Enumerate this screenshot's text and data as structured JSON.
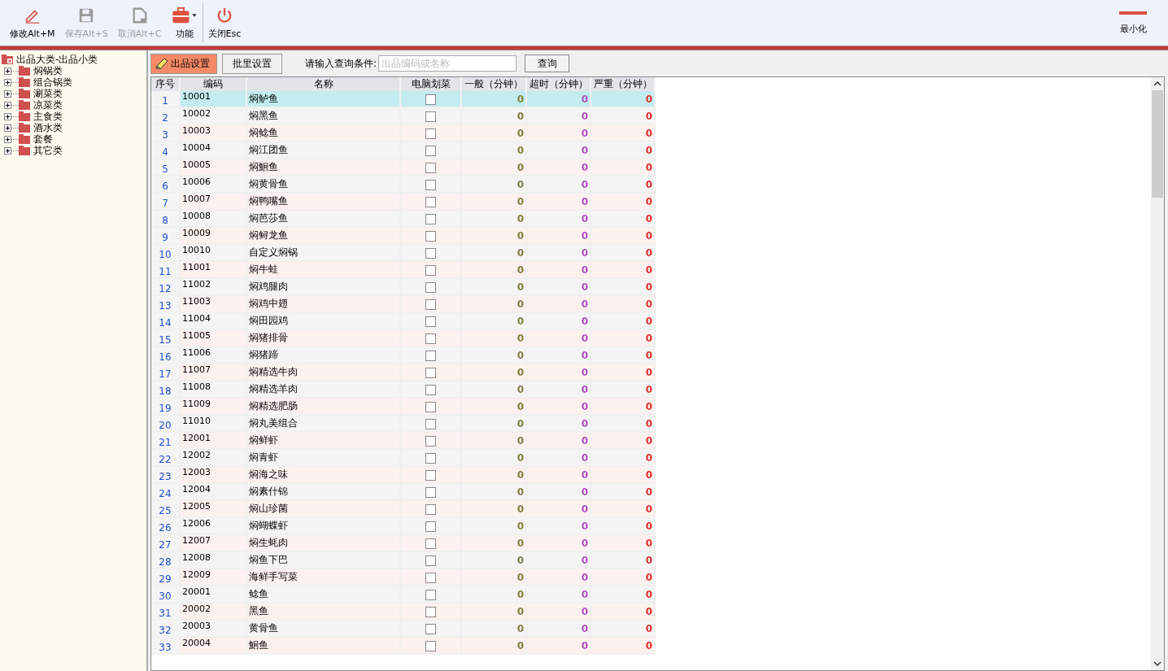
{
  "toolbar": {
    "buttons": [
      {
        "kind": "edit",
        "label": "修改Alt+M",
        "disabled": false
      },
      {
        "kind": "save",
        "label": "保存Alt+S",
        "disabled": true
      },
      {
        "kind": "cancel",
        "label": "取消Alt+C",
        "disabled": true
      },
      {
        "kind": "tools",
        "label": "功能",
        "disabled": false
      },
      {
        "kind": "power",
        "label": "关闭Esc",
        "disabled": false
      }
    ],
    "minimize": {
      "label": "最小化"
    }
  },
  "tree": {
    "root": {
      "label": "出品大类-出品小类",
      "children": [
        {
          "label": "焖锅类",
          "expanded": false
        },
        {
          "label": "组合锅类",
          "expanded": false
        },
        {
          "label": "涮菜类",
          "expanded": false
        },
        {
          "label": "凉菜类",
          "expanded": false
        },
        {
          "label": "主食类",
          "expanded": false
        },
        {
          "label": "酒水类",
          "expanded": false
        },
        {
          "label": "套餐",
          "expanded": false
        },
        {
          "label": "其它类",
          "expanded": false
        }
      ]
    }
  },
  "tabs": [
    {
      "label": "出品设置",
      "selected": true
    },
    {
      "label": "批里设置",
      "selected": false
    }
  ],
  "search": {
    "label": "请输入查询条件:",
    "placeholder": "出品编码或名称",
    "button": "查询"
  },
  "table": {
    "columns": [
      "序号",
      "编码",
      "名称",
      "电脑划菜",
      "一般（分钟）",
      "超时（分钟）",
      "严重（分钟）"
    ],
    "rows": [
      {
        "no": "1",
        "code": "10001",
        "name": "焖鲈鱼",
        "checked": false,
        "normal": "0",
        "overtime": "0",
        "severe": "0",
        "selected": true
      },
      {
        "no": "2",
        "code": "10002",
        "name": "焖黑鱼",
        "checked": false,
        "normal": "0",
        "overtime": "0",
        "severe": "0",
        "selected": false
      },
      {
        "no": "3",
        "code": "10003",
        "name": "焖鲶鱼",
        "checked": false,
        "normal": "0",
        "overtime": "0",
        "severe": "0",
        "selected": false
      },
      {
        "no": "4",
        "code": "10004",
        "name": "焖江团鱼",
        "checked": false,
        "normal": "0",
        "overtime": "0",
        "severe": "0",
        "selected": false
      },
      {
        "no": "5",
        "code": "10005",
        "name": "焖鮰鱼",
        "checked": false,
        "normal": "0",
        "overtime": "0",
        "severe": "0",
        "selected": false
      },
      {
        "no": "6",
        "code": "10006",
        "name": "焖黄骨鱼",
        "checked": false,
        "normal": "0",
        "overtime": "0",
        "severe": "0",
        "selected": false
      },
      {
        "no": "7",
        "code": "10007",
        "name": "焖鸭嘴鱼",
        "checked": false,
        "normal": "0",
        "overtime": "0",
        "severe": "0",
        "selected": false
      },
      {
        "no": "8",
        "code": "10008",
        "name": "焖芭莎鱼",
        "checked": false,
        "normal": "0",
        "overtime": "0",
        "severe": "0",
        "selected": false
      },
      {
        "no": "9",
        "code": "10009",
        "name": "焖鲟龙鱼",
        "checked": false,
        "normal": "0",
        "overtime": "0",
        "severe": "0",
        "selected": false
      },
      {
        "no": "10",
        "code": "10010",
        "name": "自定义焖锅",
        "checked": false,
        "normal": "0",
        "overtime": "0",
        "severe": "0",
        "selected": false
      },
      {
        "no": "11",
        "code": "11001",
        "name": "焖牛蛙",
        "checked": false,
        "normal": "0",
        "overtime": "0",
        "severe": "0",
        "selected": false
      },
      {
        "no": "12",
        "code": "11002",
        "name": "焖鸡腿肉",
        "checked": false,
        "normal": "0",
        "overtime": "0",
        "severe": "0",
        "selected": false
      },
      {
        "no": "13",
        "code": "11003",
        "name": "焖鸡中翅",
        "checked": false,
        "normal": "0",
        "overtime": "0",
        "severe": "0",
        "selected": false
      },
      {
        "no": "14",
        "code": "11004",
        "name": "焖田园鸡",
        "checked": false,
        "normal": "0",
        "overtime": "0",
        "severe": "0",
        "selected": false
      },
      {
        "no": "15",
        "code": "11005",
        "name": "焖猪排骨",
        "checked": false,
        "normal": "0",
        "overtime": "0",
        "severe": "0",
        "selected": false
      },
      {
        "no": "16",
        "code": "11006",
        "name": "焖猪蹄",
        "checked": false,
        "normal": "0",
        "overtime": "0",
        "severe": "0",
        "selected": false
      },
      {
        "no": "17",
        "code": "11007",
        "name": "焖精选牛肉",
        "checked": false,
        "normal": "0",
        "overtime": "0",
        "severe": "0",
        "selected": false
      },
      {
        "no": "18",
        "code": "11008",
        "name": "焖精选羊肉",
        "checked": false,
        "normal": "0",
        "overtime": "0",
        "severe": "0",
        "selected": false
      },
      {
        "no": "19",
        "code": "11009",
        "name": "焖精选肥肠",
        "checked": false,
        "normal": "0",
        "overtime": "0",
        "severe": "0",
        "selected": false
      },
      {
        "no": "20",
        "code": "11010",
        "name": "焖丸美组合",
        "checked": false,
        "normal": "0",
        "overtime": "0",
        "severe": "0",
        "selected": false
      },
      {
        "no": "21",
        "code": "12001",
        "name": "焖鲜虾",
        "checked": false,
        "normal": "0",
        "overtime": "0",
        "severe": "0",
        "selected": false
      },
      {
        "no": "22",
        "code": "12002",
        "name": "焖青虾",
        "checked": false,
        "normal": "0",
        "overtime": "0",
        "severe": "0",
        "selected": false
      },
      {
        "no": "23",
        "code": "12003",
        "name": "焖海之味",
        "checked": false,
        "normal": "0",
        "overtime": "0",
        "severe": "0",
        "selected": false
      },
      {
        "no": "24",
        "code": "12004",
        "name": "焖素什锦",
        "checked": false,
        "normal": "0",
        "overtime": "0",
        "severe": "0",
        "selected": false
      },
      {
        "no": "25",
        "code": "12005",
        "name": "焖山珍菌",
        "checked": false,
        "normal": "0",
        "overtime": "0",
        "severe": "0",
        "selected": false
      },
      {
        "no": "26",
        "code": "12006",
        "name": "焖蝴蝶虾",
        "checked": false,
        "normal": "0",
        "overtime": "0",
        "severe": "0",
        "selected": false
      },
      {
        "no": "27",
        "code": "12007",
        "name": "焖生蚝肉",
        "checked": false,
        "normal": "0",
        "overtime": "0",
        "severe": "0",
        "selected": false
      },
      {
        "no": "28",
        "code": "12008",
        "name": "焖鱼下巴",
        "checked": false,
        "normal": "0",
        "overtime": "0",
        "severe": "0",
        "selected": false
      },
      {
        "no": "29",
        "code": "12009",
        "name": "海鲜手写菜",
        "checked": false,
        "normal": "0",
        "overtime": "0",
        "severe": "0",
        "selected": false
      },
      {
        "no": "30",
        "code": "20001",
        "name": "鲶鱼",
        "checked": false,
        "normal": "0",
        "overtime": "0",
        "severe": "0",
        "selected": false
      },
      {
        "no": "31",
        "code": "20002",
        "name": "黑鱼",
        "checked": false,
        "normal": "0",
        "overtime": "0",
        "severe": "0",
        "selected": false
      },
      {
        "no": "32",
        "code": "20003",
        "name": "黄骨鱼",
        "checked": false,
        "normal": "0",
        "overtime": "0",
        "severe": "0",
        "selected": false
      },
      {
        "no": "33",
        "code": "20004",
        "name": "鮰鱼",
        "checked": false,
        "normal": "0",
        "overtime": "0",
        "severe": "0",
        "selected": false
      }
    ]
  }
}
